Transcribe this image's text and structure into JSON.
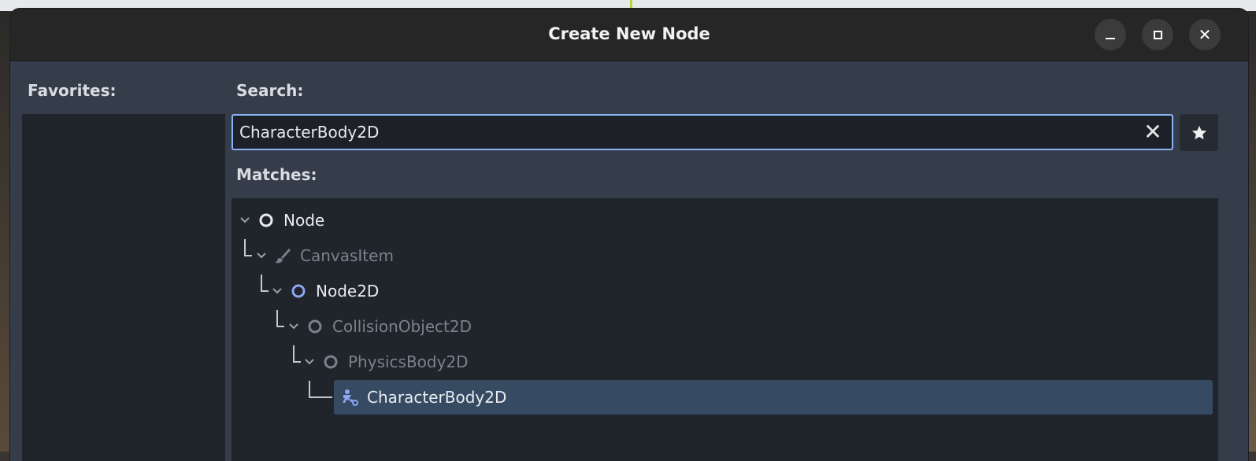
{
  "window": {
    "title": "Create New Node"
  },
  "favorites": {
    "label": "Favorites:"
  },
  "search": {
    "label": "Search:",
    "value": "CharacterBody2D"
  },
  "matches": {
    "label": "Matches:",
    "tree": [
      {
        "label": "Node",
        "icon": "circle-icon",
        "dimmed": false
      },
      {
        "label": "CanvasItem",
        "icon": "brush-icon",
        "dimmed": true
      },
      {
        "label": "Node2D",
        "icon": "circle-icon",
        "dimmed": false
      },
      {
        "label": "CollisionObject2D",
        "icon": "circle-icon",
        "dimmed": true
      },
      {
        "label": "PhysicsBody2D",
        "icon": "circle-icon",
        "dimmed": true
      },
      {
        "label": "CharacterBody2D",
        "icon": "character-body-icon",
        "dimmed": false,
        "selected": true
      }
    ]
  },
  "colors": {
    "accent": "#8ab4f8",
    "node2d_icon": "#8da5f3",
    "selection": "#364b62"
  }
}
